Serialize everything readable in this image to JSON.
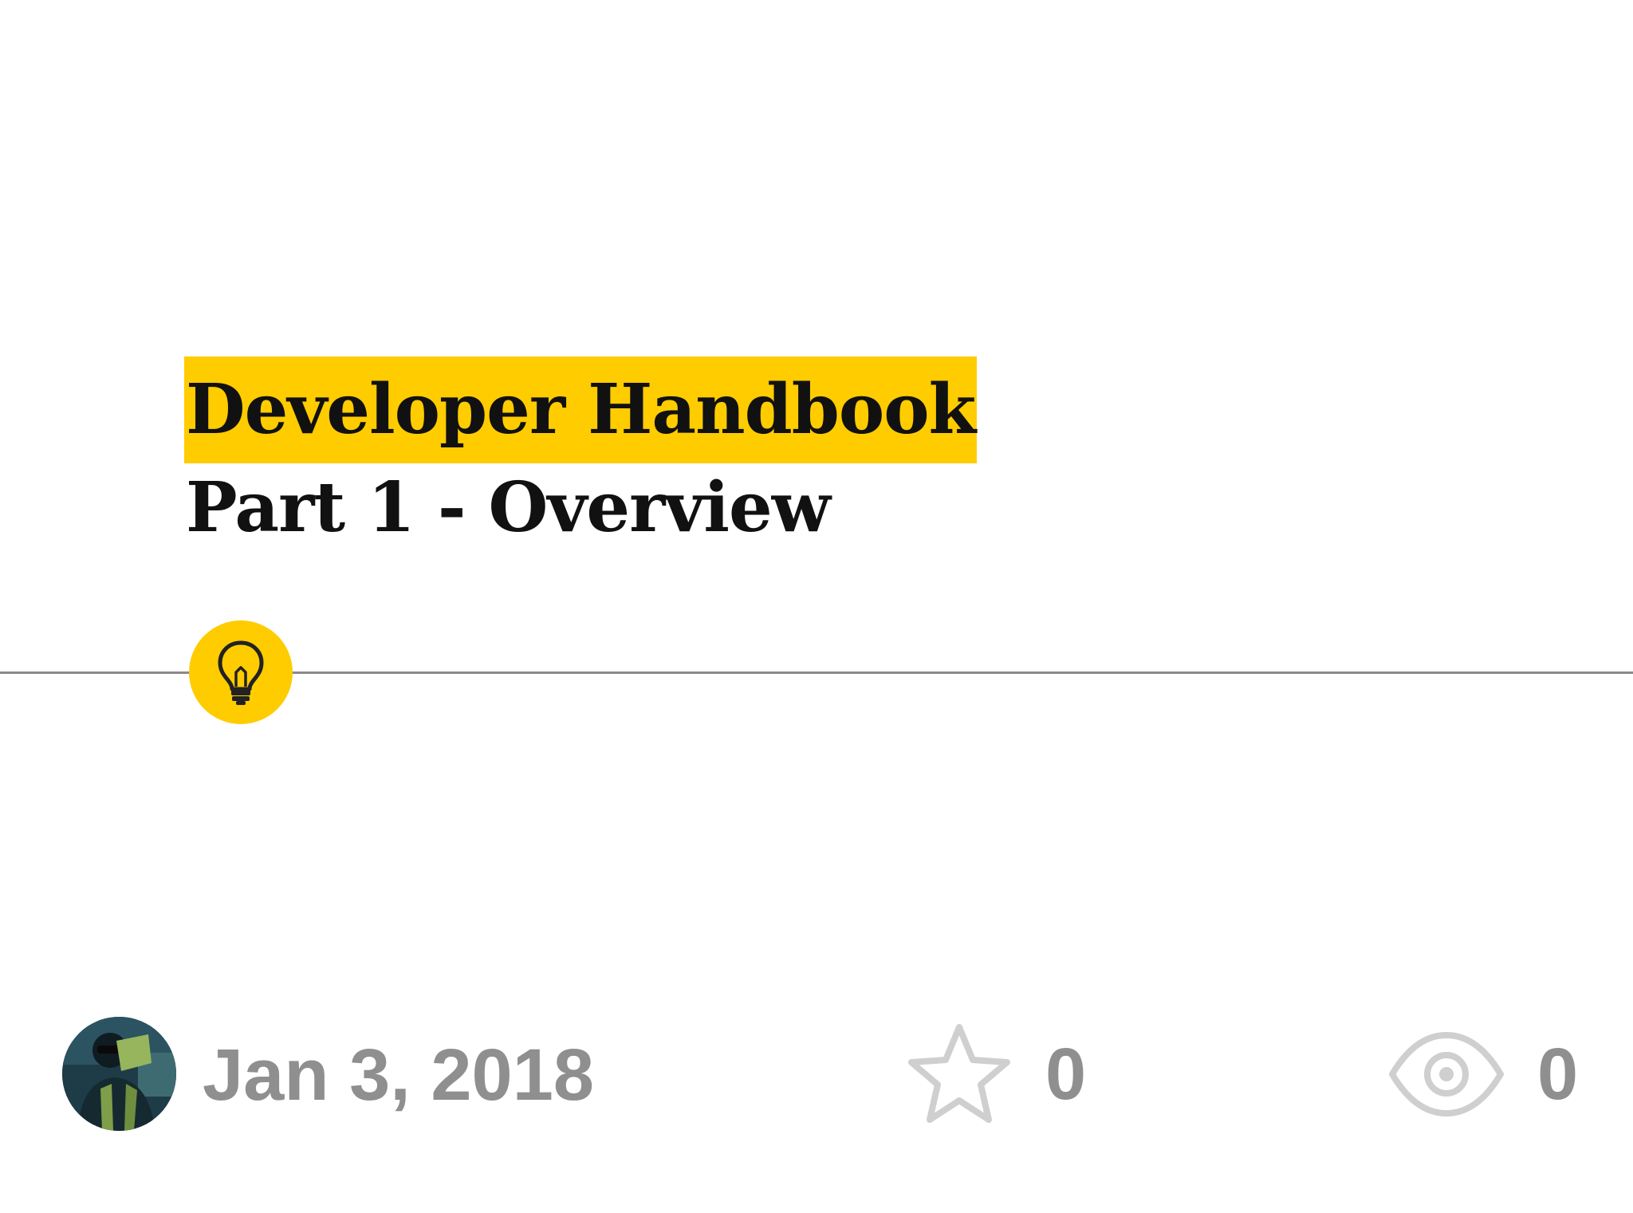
{
  "card": {
    "title": "Developer Handbook",
    "subtitle": "Part 1 - Overview",
    "category_icon": "lightbulb-icon",
    "accent_color": "#ffcc00"
  },
  "footer": {
    "date": "Jan 3, 2018",
    "stars_icon": "star-icon",
    "stars_count": "0",
    "views_icon": "eye-icon",
    "views_count": "0",
    "meta_color": "#8f8f8f"
  }
}
